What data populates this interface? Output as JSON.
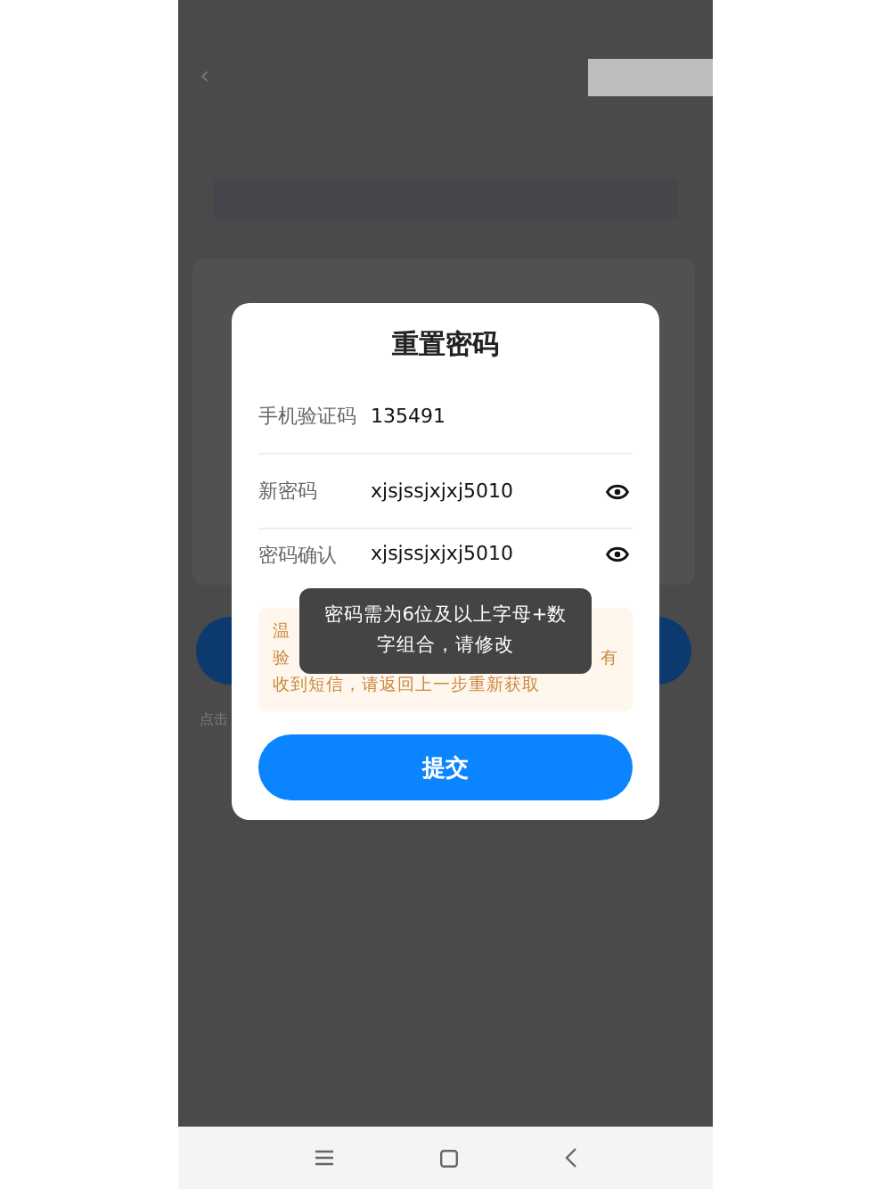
{
  "background": {
    "back_icon": "‹",
    "footnote": "点击"
  },
  "dialog": {
    "title": "重置密码",
    "fields": [
      {
        "label": "手机验证码",
        "value": "135491",
        "kind": "code"
      },
      {
        "label": "新密码",
        "value": "xjsjssjxjxj5010",
        "kind": "password"
      },
      {
        "label": "密码确认",
        "value": "xjsjssjxjxj5010",
        "kind": "password"
      }
    ],
    "tip": {
      "line_1": "温",
      "line_2_start": "验",
      "line_2_end": "有",
      "line_3": "收到短信，请返回上一步重新获取"
    },
    "submit": "提交"
  },
  "toast": "密码需为6位及以上字母+数字组合，请修改",
  "nav_bar": [
    {
      "kind": "menu"
    },
    {
      "kind": "home"
    },
    {
      "kind": "back"
    }
  ]
}
